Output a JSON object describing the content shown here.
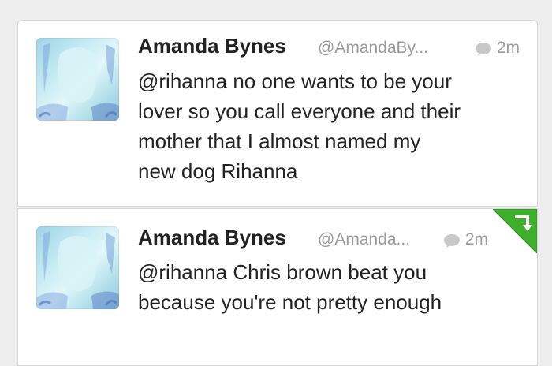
{
  "tweets": [
    {
      "author_name": "Amanda Bynes",
      "handle": "@AmandaBy...",
      "time": "2m",
      "text_lines": [
        "@rihanna no one wants to be your",
        "lover so you call everyone and their",
        "mother that I almost named my",
        "new dog Rihanna"
      ],
      "avatar_icon": "profile-photo",
      "meta_icon": "speech-bubble-icon"
    },
    {
      "author_name": "Amanda Bynes",
      "handle": "@Amanda...",
      "time": "2m",
      "text_lines": [
        "@rihanna Chris brown beat you",
        "because you're not pretty enough"
      ],
      "avatar_icon": "profile-photo",
      "meta_icon": "speech-bubble-icon",
      "corner_icon": "retweet-corner-icon",
      "corner_color": "#3fae2a"
    }
  ],
  "colors": {
    "background": "#eeeeee",
    "card": "#ffffff",
    "text": "#222222",
    "muted": "#9a9a9a",
    "retweet_green": "#3fae2a"
  }
}
